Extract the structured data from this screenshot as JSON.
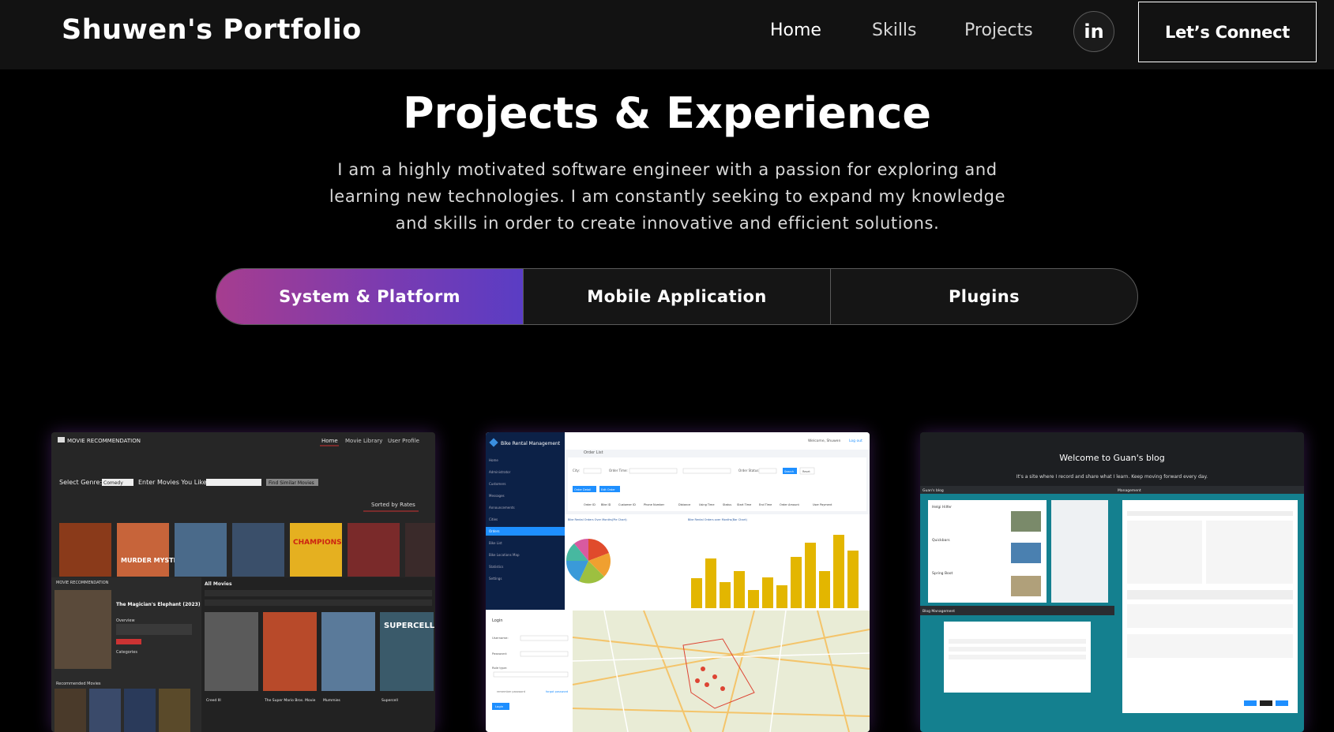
{
  "nav": {
    "brand": "Shuwen's Portfolio",
    "links": [
      "Home",
      "Skills",
      "Projects"
    ],
    "social_icon": "linkedin-icon",
    "social_label": "in",
    "cta": "Let’s Connect"
  },
  "projects": {
    "title": "Projects & Experience",
    "intro": "I am a highly motivated software engineer with a passion for exploring and learning new technologies. I am constantly seeking to expand my knowledge and skills in order to create innovative and efficient solutions.",
    "tabs": [
      "System & Platform",
      "Mobile Application",
      "Plugins"
    ],
    "active_tab": 0
  },
  "cards": {
    "movie": {
      "app_name": "MOVIE RECOMMENDATION",
      "nav": [
        "Home",
        "Movie Library",
        "User Profile"
      ],
      "select_genre_label": "Select Genre:",
      "genre_value": "Comedy",
      "enter_movies_label": "Enter Movies You Like:",
      "find_button": "Find Similar Movies",
      "sorted_by": "Sorted by Rates",
      "poster_texts": [
        "MURDER MYSTERY",
        "CHAMPIONS"
      ],
      "lower_app_name": "MOVIE RECOMMENDATION",
      "featured_title": "The Magician's Elephant (2023)",
      "overview_label": "Overview",
      "categories_label": "Categories",
      "all_movies_label": "All Movies",
      "recommended_label": "Recommended Movies",
      "grid_posters": [
        "SUPERCELL"
      ],
      "grid_titles": [
        "Creed III",
        "The Super Mario Bros. Movie",
        "Mummies",
        "Supercell"
      ]
    },
    "bike": {
      "app_name": "Bike Rental Management",
      "welcome": "Welcome, Shuwen",
      "logout": "Log out",
      "page_title": "Order List",
      "sidebar": [
        "Home",
        "Administrator",
        "Customers",
        "Messages",
        "Announcements",
        "Cities",
        "Orders",
        "Bike List",
        "Bike Locations Map",
        "Statistics",
        "Settings"
      ],
      "filters": [
        "City:",
        "Order Time:",
        "Order Status:"
      ],
      "buttons": [
        "Search",
        "Reset",
        "Order Detail",
        "Edit Order"
      ],
      "columns": [
        "Order ID",
        "Bike ID",
        "Customer ID",
        "Phone Number",
        "Distance",
        "Using Time",
        "Status",
        "Start Time",
        "End Time",
        "Order Amount",
        "User Payment"
      ],
      "chart_titles": [
        "Bike Rental Orders Over Months(Pie Chart)",
        "Bike Rental Orders over Months(Bar Chart)"
      ],
      "login_title": "Login",
      "login_fields": [
        "Username:",
        "Password:",
        "Role type:"
      ],
      "remember": "remember password",
      "forgot": "forgot password",
      "login_button": "Login"
    },
    "blog": {
      "welcome": "Welcome to Guan's blog",
      "tagline": "It's a site where I record and share what I learn. Keep moving forward every day.",
      "blog_label": "Guan's blog",
      "posts": [
        "Helgi Hilfer",
        "Quickbars",
        "Spring Boot"
      ],
      "management_title": "Blog Management",
      "management_label": "Management"
    },
    "colors": {
      "tab_gradient_start": "#a63d8f",
      "tab_gradient_end": "#5a3dc4",
      "bar_color": "#e3b600",
      "sidebar_color": "#0c2147",
      "blog_teal": "#14808f"
    }
  }
}
